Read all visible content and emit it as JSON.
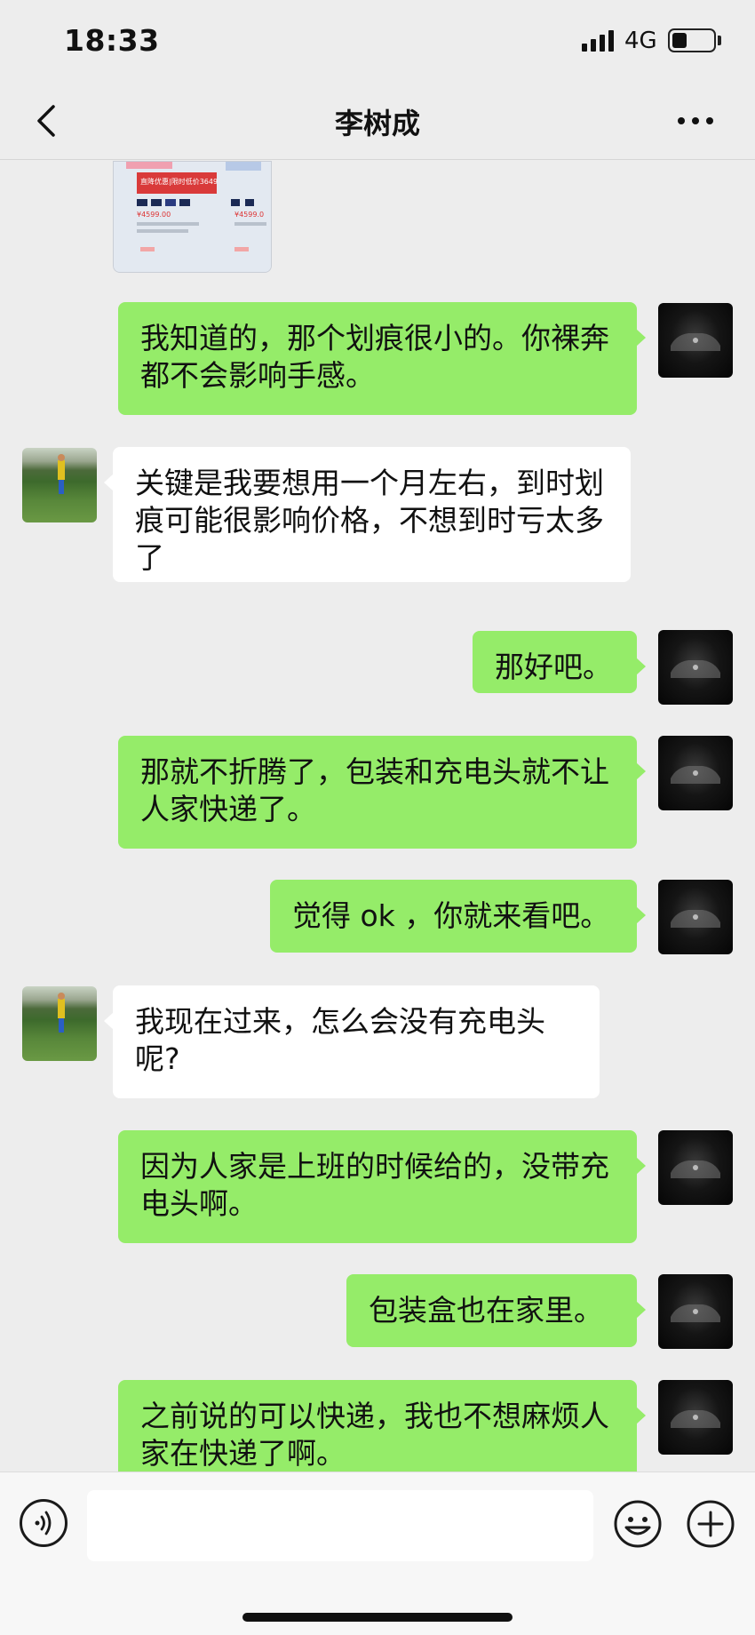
{
  "status_bar": {
    "time": "18:33",
    "network": "4G"
  },
  "nav": {
    "title": "李树成"
  },
  "image_message": {
    "banner": "直降优惠|限时低价3649",
    "price_left": "¥4599.00",
    "price_right": "¥4599.0"
  },
  "messages": [
    {
      "side": "me",
      "text": "我知道的，那个划痕很小的。你裸奔都不会影响手感。"
    },
    {
      "side": "them",
      "text": "关键是我要想用一个月左右，到时划痕可能很影响价格，不想到时亏太多了"
    },
    {
      "side": "me",
      "text": "那好吧。"
    },
    {
      "side": "me",
      "text": "那就不折腾了，包装和充电头就不让人家快递了。"
    },
    {
      "side": "me",
      "text": "觉得 ok ，你就来看吧。"
    },
    {
      "side": "them",
      "text": "我现在过来，怎么会没有充电头呢?"
    },
    {
      "side": "me",
      "text": "因为人家是上班的时候给的，没带充电头啊。"
    },
    {
      "side": "me",
      "text": "包装盒也在家里。"
    },
    {
      "side": "me",
      "text": "之前说的可以快递，我也不想麻烦人家在快递了啊。"
    }
  ],
  "input": {
    "value": "",
    "placeholder": ""
  },
  "colors": {
    "sent_bubble": "#95ec69",
    "received_bubble": "#ffffff",
    "background": "#ededed"
  }
}
